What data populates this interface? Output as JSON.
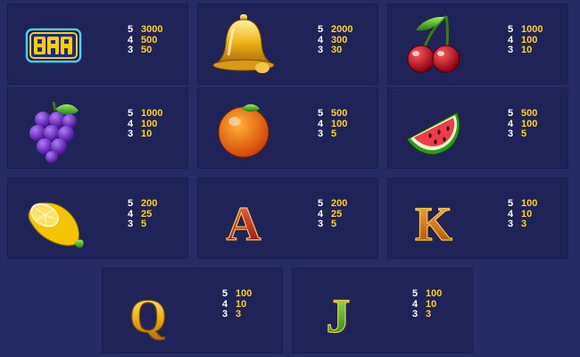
{
  "paytable": [
    {
      "symbol": "BAR",
      "icon": "bar-icon",
      "pays": [
        {
          "count": "5",
          "value": "3000"
        },
        {
          "count": "4",
          "value": "500"
        },
        {
          "count": "3",
          "value": "50"
        }
      ]
    },
    {
      "symbol": "Bell",
      "icon": "bell-icon",
      "pays": [
        {
          "count": "5",
          "value": "2000"
        },
        {
          "count": "4",
          "value": "300"
        },
        {
          "count": "3",
          "value": "30"
        }
      ]
    },
    {
      "symbol": "Cherry",
      "icon": "cherry-icon",
      "pays": [
        {
          "count": "5",
          "value": "1000"
        },
        {
          "count": "4",
          "value": "100"
        },
        {
          "count": "3",
          "value": "10"
        }
      ]
    },
    {
      "symbol": "Grapes",
      "icon": "grapes-icon",
      "pays": [
        {
          "count": "5",
          "value": "1000"
        },
        {
          "count": "4",
          "value": "100"
        },
        {
          "count": "3",
          "value": "10"
        }
      ]
    },
    {
      "symbol": "Orange",
      "icon": "orange-icon",
      "pays": [
        {
          "count": "5",
          "value": "500"
        },
        {
          "count": "4",
          "value": "100"
        },
        {
          "count": "3",
          "value": "5"
        }
      ]
    },
    {
      "symbol": "Watermelon",
      "icon": "watermelon-icon",
      "pays": [
        {
          "count": "5",
          "value": "500"
        },
        {
          "count": "4",
          "value": "100"
        },
        {
          "count": "3",
          "value": "5"
        }
      ]
    },
    {
      "symbol": "Lemon",
      "icon": "lemon-icon",
      "pays": [
        {
          "count": "5",
          "value": "200"
        },
        {
          "count": "4",
          "value": "25"
        },
        {
          "count": "3",
          "value": "5"
        }
      ]
    },
    {
      "symbol": "A",
      "icon": "letter-a-icon",
      "pays": [
        {
          "count": "5",
          "value": "200"
        },
        {
          "count": "4",
          "value": "25"
        },
        {
          "count": "3",
          "value": "5"
        }
      ]
    },
    {
      "symbol": "K",
      "icon": "letter-k-icon",
      "pays": [
        {
          "count": "5",
          "value": "100"
        },
        {
          "count": "4",
          "value": "10"
        },
        {
          "count": "3",
          "value": "3"
        }
      ]
    },
    {
      "symbol": "Q",
      "icon": "letter-q-icon",
      "pays": [
        {
          "count": "5",
          "value": "100"
        },
        {
          "count": "4",
          "value": "10"
        },
        {
          "count": "3",
          "value": "3"
        }
      ]
    },
    {
      "symbol": "J",
      "icon": "letter-j-icon",
      "pays": [
        {
          "count": "5",
          "value": "100"
        },
        {
          "count": "4",
          "value": "10"
        },
        {
          "count": "3",
          "value": "3"
        }
      ]
    }
  ],
  "colors": {
    "background": "#262b66",
    "panel": "#1f2358",
    "count_text": "#ffffff",
    "value_text": "#ffd21e"
  }
}
